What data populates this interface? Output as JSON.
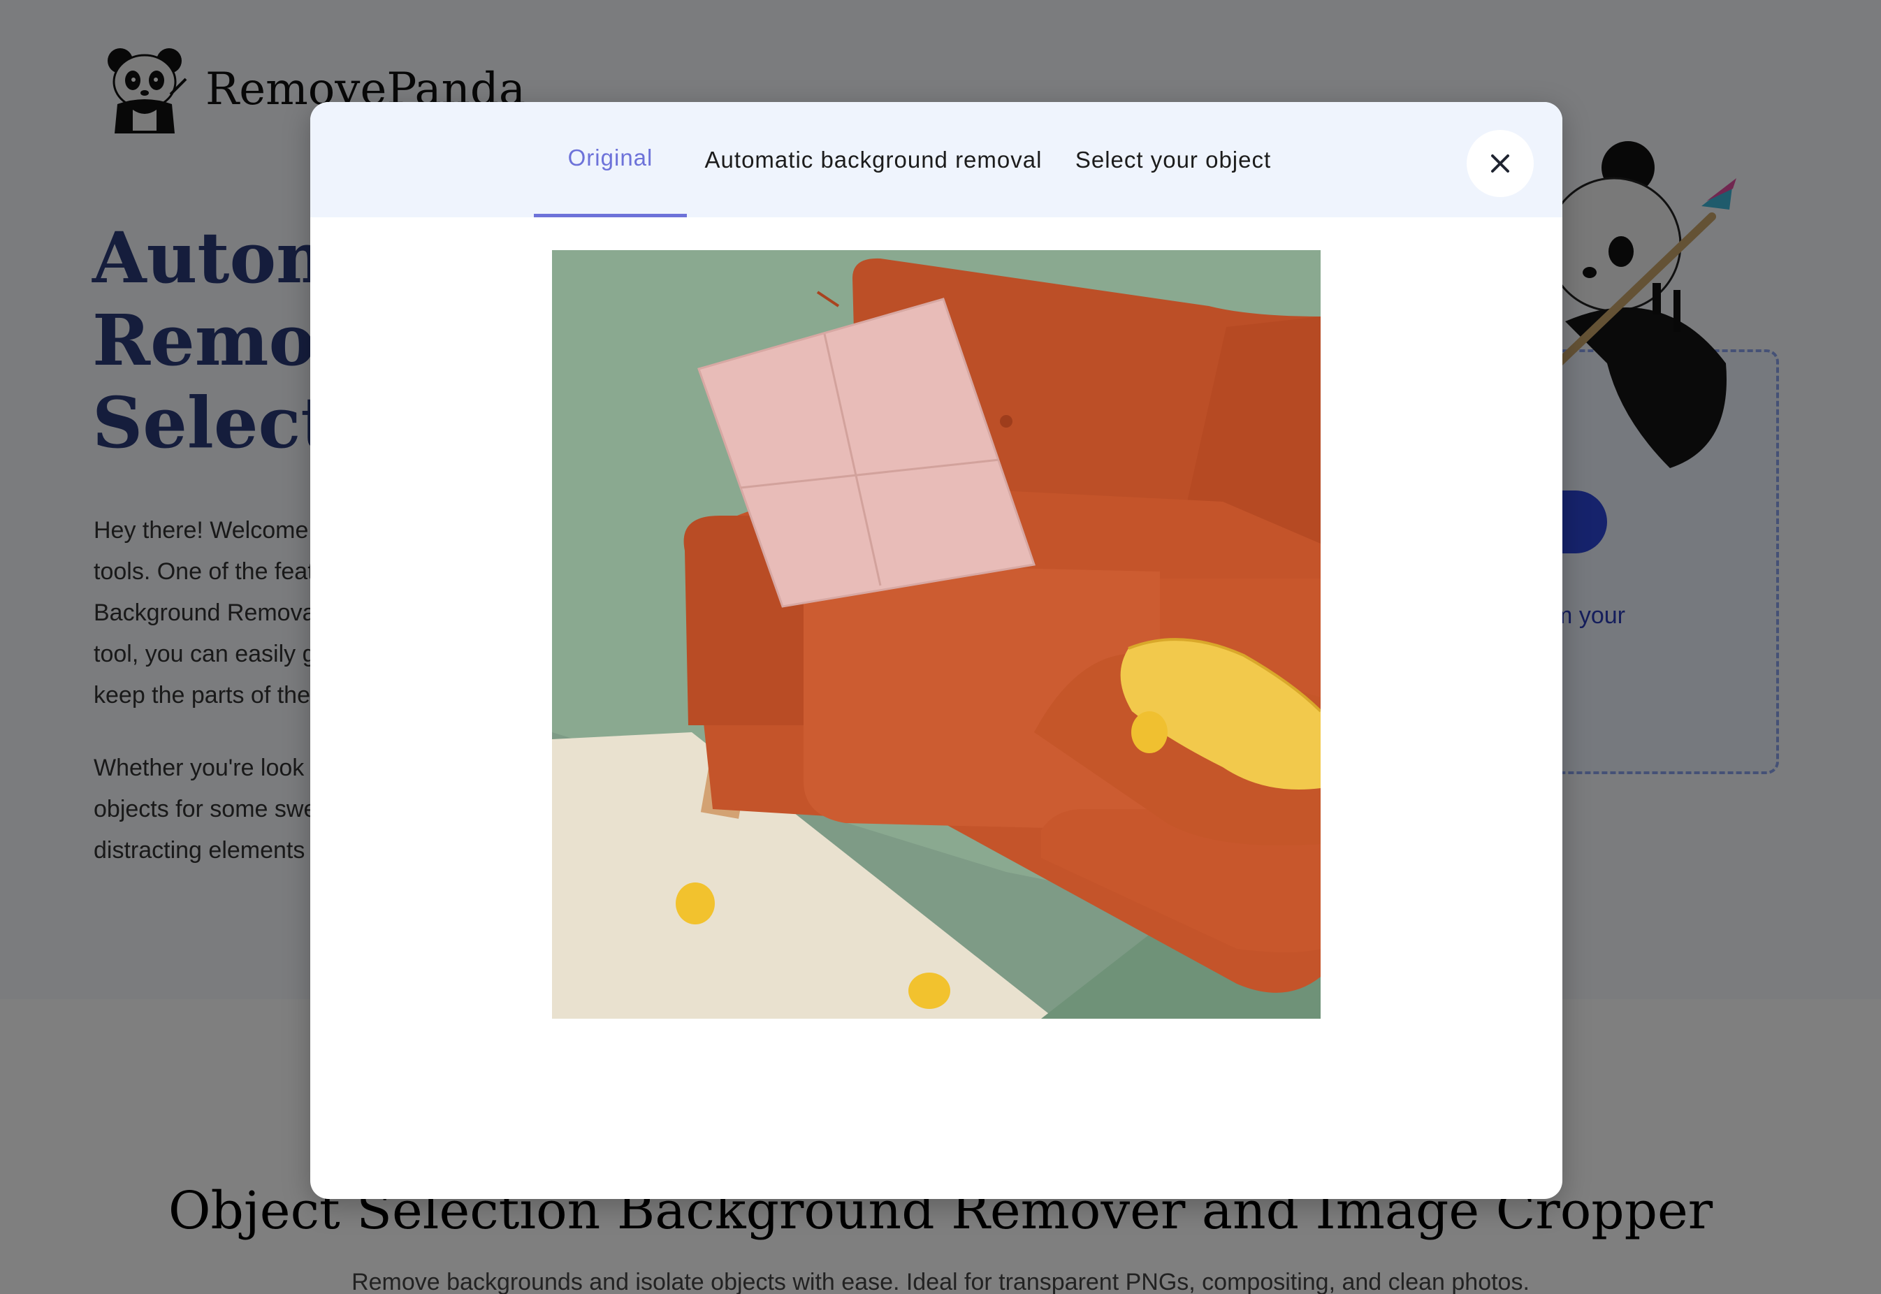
{
  "brand": {
    "name": "RemovePanda",
    "logo_icon": "panda-logo-icon"
  },
  "hero": {
    "title_lines": [
      "Automa",
      "Remova",
      "Selecti"
    ],
    "paragraph1_lines": [
      "Hey there! Welcome",
      "tools. One of the feat",
      "Background Remova",
      "tool, you can easily g",
      "keep the parts of the"
    ],
    "paragraph2_lines": [
      "Whether you're look",
      "objects for some swe",
      "distracting elements"
    ]
  },
  "upload_panel": {
    "text_fragment": "e from your",
    "button_color": "#2c46d8"
  },
  "section": {
    "title": "Object Selection Background Remover and Image Cropper",
    "subtitle": "Remove backgrounds and isolate objects with ease. Ideal for transparent PNGs, compositing, and clean photos."
  },
  "modal": {
    "tabs": [
      {
        "label": "Original",
        "active": true
      },
      {
        "label": "Automatic background removal",
        "active": false
      },
      {
        "label": "Select your object",
        "active": false
      }
    ],
    "close_icon": "close-icon",
    "image_subject": "orange sofa with pink pillow, yellow net bag and lemons on a rug"
  },
  "colors": {
    "accent": "#6d72d9",
    "header_bg": "#eff4fd",
    "hero_title": "#2b3a78",
    "sofa": "#c4542a",
    "wall": "#8aa990"
  }
}
